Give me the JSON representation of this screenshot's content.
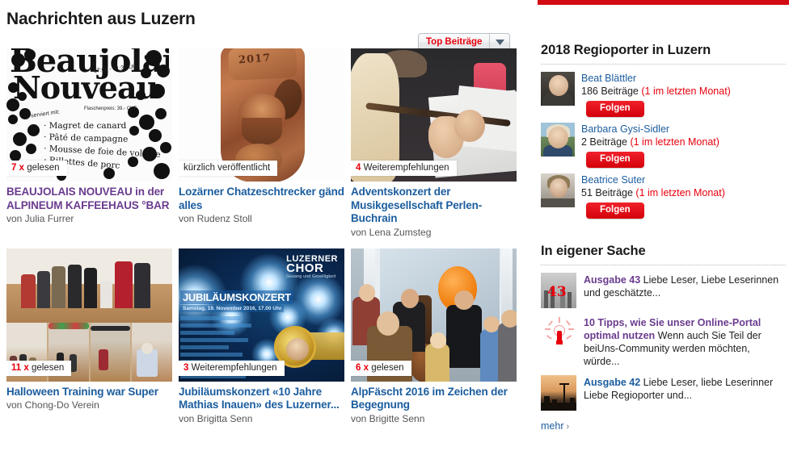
{
  "page": {
    "title": "Nachrichten aus Luzern"
  },
  "sort": {
    "label": "Top Beiträge",
    "icon": "chevron-down-icon"
  },
  "articles": [
    {
      "badge_count": "7 x",
      "badge_text": "gelesen",
      "title": "BEAUJOLAIS NOUVEAU in der ALPINEUM KAFFEEHAUS °BAR",
      "author": "von Julia Furrer",
      "visited": true,
      "image": "beaujolais-nouveau-poster",
      "poster": {
        "line1": "Beaujolais",
        "line2": "Nouveau",
        "time": "17:00 - 01:30 Uhr",
        "price": "Flaschenpreis: 39.- CHF",
        "served": "serviert mit:",
        "menu": [
          "· Magret de canard",
          "· Pâté de campagne",
          "· Mousse de foie de volaille",
          "· Rillettes de porc"
        ]
      }
    },
    {
      "badge_count": "",
      "badge_text": "kürzlich veröffentlicht",
      "title": "Lozärner Chatzeschtrecker gänd alles",
      "author": "von Rudenz Stoll",
      "visited": false,
      "image": "carved-bronze-figure",
      "carving": {
        "year": "2017"
      }
    },
    {
      "badge_count": "4",
      "badge_text": "Weiterempfehlungen",
      "title": "Adventskonzert der Musikgesellschaft Perlen-Buchrain",
      "author": "von Lena Zumsteg",
      "visited": false,
      "image": "flute-player-photo"
    },
    {
      "badge_count": "11 x",
      "badge_text": "gelesen",
      "title": "Halloween Training war Super",
      "author": "von Chong-Do Verein",
      "visited": false,
      "image": "halloween-collage-photo"
    },
    {
      "badge_count": "3",
      "badge_text": "Weiterempfehlungen",
      "title": "Jubiläumskonzert «10 Jahre Mathias Inauen» des Luzerner...",
      "author": "von Brigitta Senn",
      "visited": false,
      "image": "jubilaeumskonzert-poster",
      "poster": {
        "logo_line1": "LUZERNER",
        "logo_line2": "CHOR",
        "logo_line3": "Gesang und Geselligkeit",
        "title": "JUBILÄUMSKONZERT",
        "subtitle": "Samstag, 19. November 2016, 17.00 Uhr"
      }
    },
    {
      "badge_count": "6 x",
      "badge_text": "gelesen",
      "title": "AlpFäscht 2016 im Zeichen der Begegnung",
      "author": "von Brigitte Senn",
      "visited": false,
      "image": "alpfaescht-street-photo"
    }
  ],
  "sidebar": {
    "regioporter": {
      "heading": "2018 Regioporter in Luzern",
      "follow_label": "Folgen",
      "people": [
        {
          "name": "Beat Blättler",
          "posts": "186 Beiträge",
          "recent": "(1 im letzten Monat)",
          "avatar": "avatar-beat-blaettler"
        },
        {
          "name": "Barbara Gysi-Sidler",
          "posts": "2 Beiträge",
          "recent": "(1 im letzten Monat)",
          "avatar": "avatar-barbara-gysi-sidler"
        },
        {
          "name": "Beatrice Suter",
          "posts": "51 Beiträge",
          "recent": "(1 im letzten Monat)",
          "avatar": "avatar-beatrice-suter"
        }
      ]
    },
    "eigene_sache": {
      "heading": "In eigener Sache",
      "more_label": "mehr",
      "more_icon": "chevron-right-icon",
      "items": [
        {
          "lead": "Ausgabe 43",
          "body": " Liebe Leser, Liebe Leserinnen und geschätzte...",
          "visited": true,
          "thumb": "thumb-street-43"
        },
        {
          "lead": "10 Tipps, wie Sie unser Online-Portal optimal nutzen",
          "body": " Wenn auch Sie Teil der beiUns-Community werden möchten, würde...",
          "visited": true,
          "thumb": "thumb-lightbulb"
        },
        {
          "lead": "Ausgabe 42",
          "body": " Liebe Leser, liebe Leserinner Liebe Regioporter und...",
          "visited": false,
          "thumb": "thumb-sunset-silhouette"
        }
      ]
    }
  },
  "colors": {
    "brand_red": "#d20a11",
    "link_blue": "#1b5d9e",
    "link_visited": "#6a3b8e",
    "accent_red": "#e8000d"
  }
}
